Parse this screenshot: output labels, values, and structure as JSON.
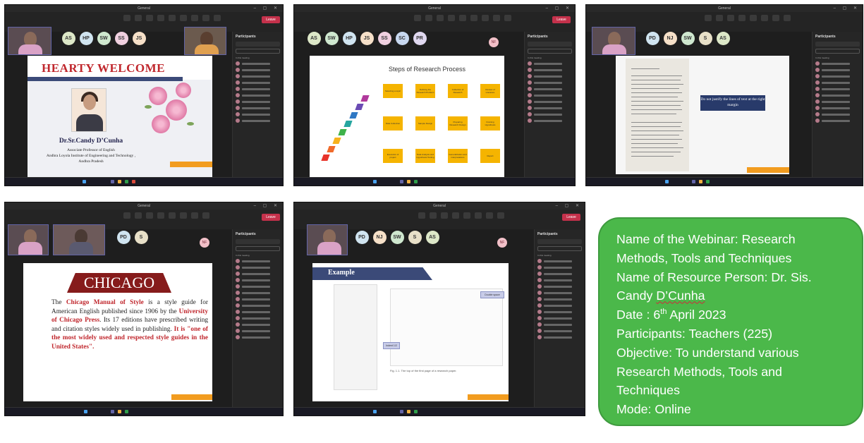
{
  "meeting": {
    "window_title": "General",
    "leave_label": "Leave",
    "participants_header": "Participants",
    "share_invite": "Share invite",
    "in_meeting": "In this meeting"
  },
  "shot1": {
    "avatars": [
      "AS",
      "HP",
      "SW",
      "SS",
      "JS"
    ],
    "avatar_colors": [
      "#dde8c8",
      "#d0e4f0",
      "#cfe8cf",
      "#f0d0e0",
      "#f6e0c8"
    ],
    "slide": {
      "title": "HEARTY WELCOME",
      "name": "Dr.Sr.Candy D’Cunha",
      "role": "Associate Professor of English",
      "institute": "Andhra Loyola Institute of Engineering and Technology ,",
      "state": "Andhra Pradesh"
    }
  },
  "shot2": {
    "avatars": [
      "AS",
      "SW",
      "HP",
      "JS",
      "SS",
      "SC",
      "PR"
    ],
    "avatar_colors": [
      "#dde8c8",
      "#cfe8cf",
      "#d0e4f0",
      "#f6e0c8",
      "#f0d0e0",
      "#c8d8f0",
      "#e0d8f0"
    ],
    "avatar_extra": "NF",
    "slide": {
      "title": "Steps of Research Process",
      "steps": [
        "Selecting a topic",
        "Defining the Research Problem",
        "Collection of Research",
        "Review of Literature",
        "Data Collection",
        "Sample Design",
        "Preparing Research Design",
        "Framing Hypothesis",
        "Execution of project",
        "Data Analysis and Hypothesis Testing",
        "Generalization and interpretations",
        "Report"
      ]
    }
  },
  "shot3": {
    "avatars": [
      "PD",
      "NJ",
      "SW",
      "S",
      "AS"
    ],
    "avatar_colors": [
      "#d0e4f0",
      "#f6e0c8",
      "#cfe8cf",
      "#e8e0c8",
      "#dde8c8"
    ],
    "slide": {
      "callout": "Do not justify the lines of text at the right margin"
    }
  },
  "shot4": {
    "avatars": [
      "PD",
      "S"
    ],
    "avatar_colors": [
      "#d0e4f0",
      "#e8e0c8"
    ],
    "avatar_extra": "NF",
    "slide": {
      "title": "CHICAGO",
      "t1": "The ",
      "t2": "Chicago Manual of Style",
      "t3": " is a style guide for American English published since 1906 by the ",
      "t4": "University of Chicago Press",
      "t5": ". Its 17 editions have prescribed writing and citation styles widely used in publishing. ",
      "t6": "It is \"one of the most widely used and respected style guides in the United States",
      "t7": "\"."
    }
  },
  "shot5": {
    "avatars": [
      "PD",
      "NJ",
      "SW",
      "S",
      "AS"
    ],
    "avatar_colors": [
      "#d0e4f0",
      "#f6e0c8",
      "#cfe8cf",
      "#e8e0c8",
      "#dde8c8"
    ],
    "avatar_extra": "NF",
    "slide": {
      "title": "Example",
      "callout_a": "Double space",
      "callout_b": "Indent 1/2",
      "caption": "Fig. 1.1. The top of the first page of a research paper."
    }
  },
  "info": {
    "line1": "Name of the Webinar: Research",
    "line2": "Methods, Tools and Techniques",
    "line3": "Name of Resource Person: Dr. Sis.",
    "line4a": "Candy ",
    "line4b": "D’Cunha",
    "line5a": "Date : 6",
    "line5sup": "th",
    "line5b": " April 2023",
    "line6": "Participants: Teachers (225)",
    "line7": "Objective: To understand various",
    "line8": "Research Methods, Tools and",
    "line9": "Techniques",
    "line10": "Mode: Online"
  },
  "colors": {
    "card": "#4bb84a",
    "teams_bg": "#1e1e1e",
    "leave": "#c4314b",
    "accent": "#6264a7"
  }
}
